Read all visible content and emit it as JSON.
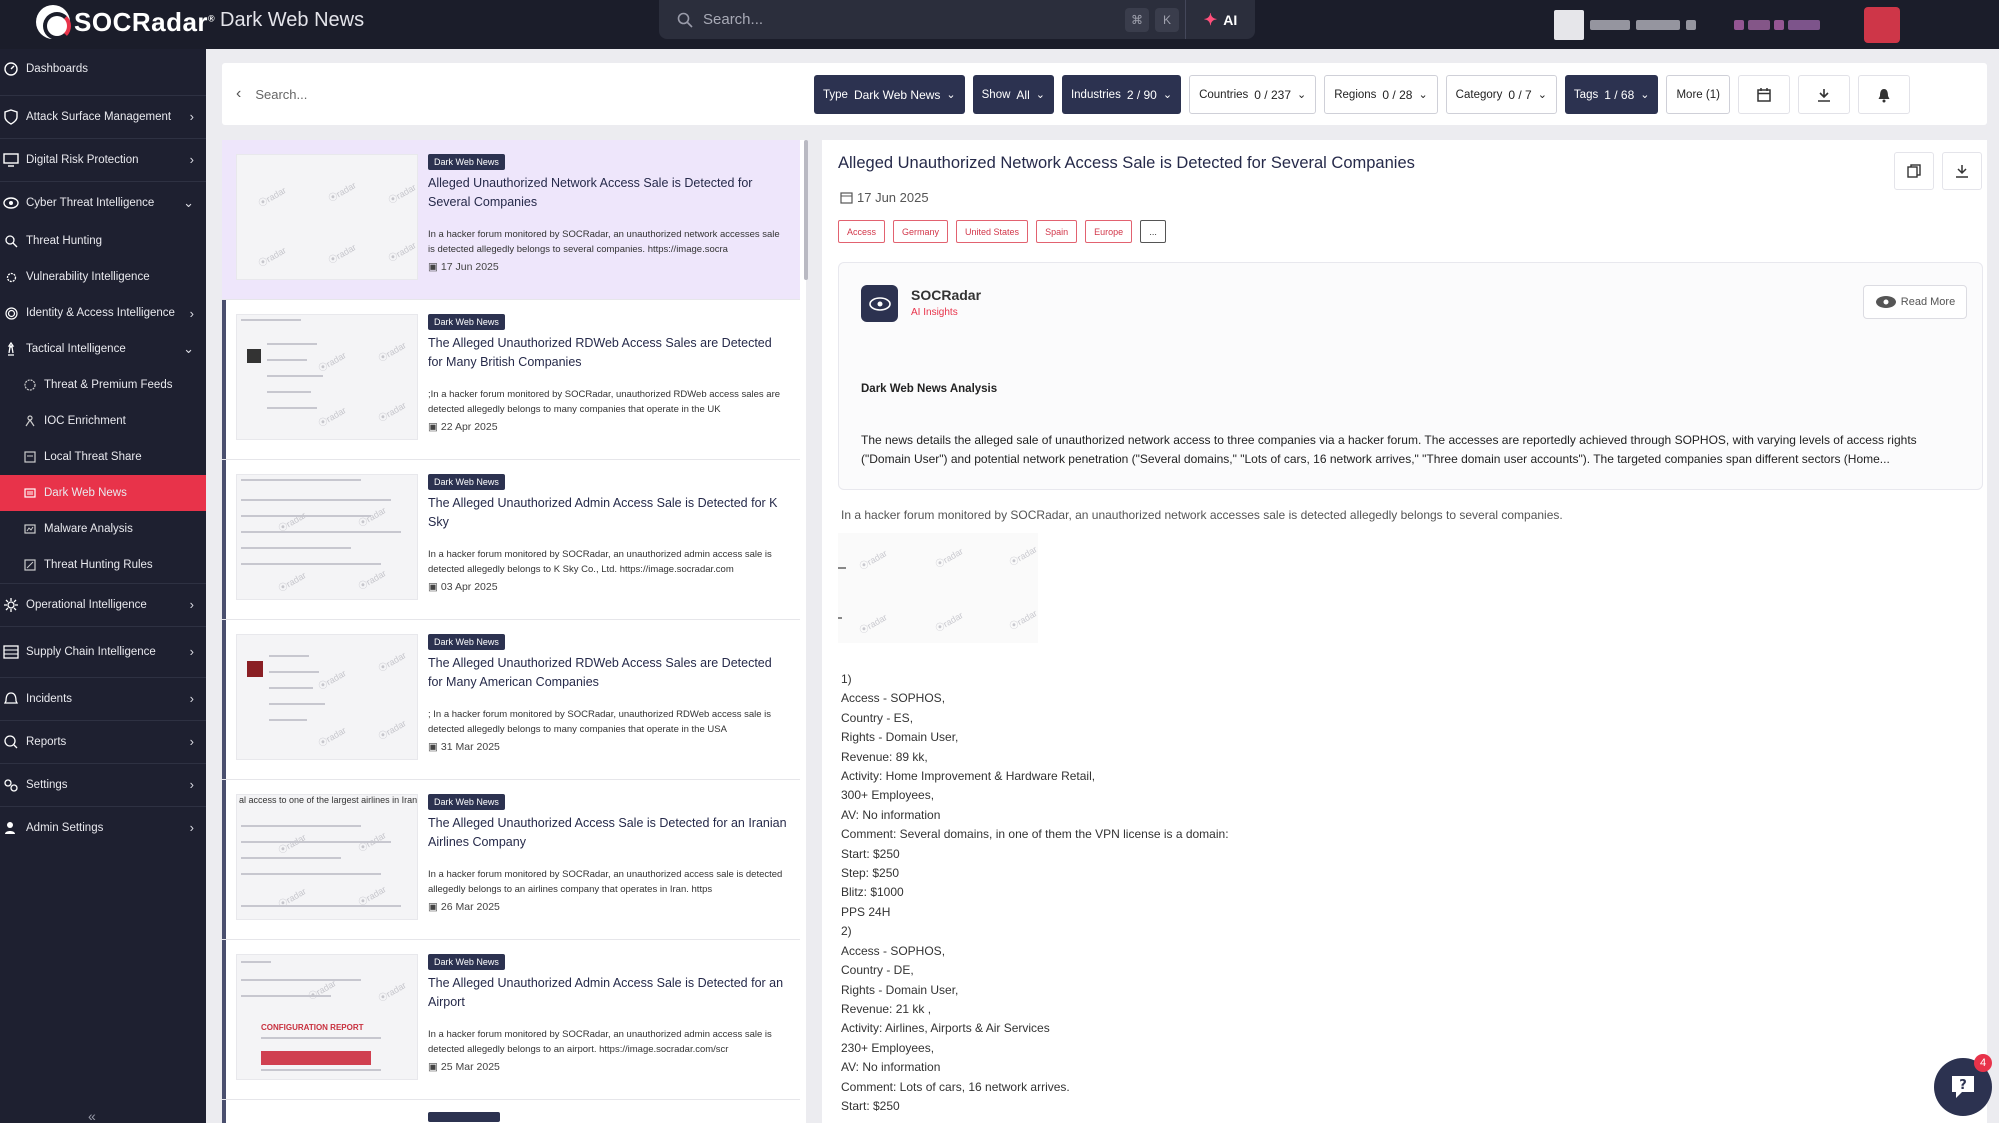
{
  "app": {
    "logo": "SOCRadar",
    "logo_mark": "®",
    "page_title": "Dark Web News"
  },
  "global_search": {
    "placeholder": "Search...",
    "kbd1": "⌘",
    "kbd2": "K",
    "ai_label": "AI"
  },
  "sidebar": {
    "items": [
      {
        "label": "Dashboards",
        "icon": "dashboard-icon",
        "chevron": ""
      },
      {
        "label": "Attack Surface Management",
        "icon": "shield-icon",
        "chevron": "›"
      },
      {
        "label": "Digital Risk Protection",
        "icon": "monitor-icon",
        "chevron": "›"
      },
      {
        "label": "Cyber Threat Intelligence",
        "icon": "eye-icon",
        "chevron": "⌄"
      },
      {
        "label": "Threat Hunting",
        "icon": "search-icon",
        "chevron": ""
      },
      {
        "label": "Vulnerability Intelligence",
        "icon": "gear-icon",
        "chevron": ""
      },
      {
        "label": "Identity & Access Intelligence",
        "icon": "fingerprint-icon",
        "chevron": "›"
      },
      {
        "label": "Tactical Intelligence",
        "icon": "chess-icon",
        "chevron": "⌄"
      },
      {
        "label": "Threat & Premium Feeds",
        "icon": "feed-icon",
        "chevron": ""
      },
      {
        "label": "IOC Enrichment",
        "icon": "network-icon",
        "chevron": ""
      },
      {
        "label": "Local Threat Share",
        "icon": "share-icon",
        "chevron": ""
      },
      {
        "label": "Dark Web News",
        "icon": "news-icon",
        "chevron": ""
      },
      {
        "label": "Malware Analysis",
        "icon": "malware-icon",
        "chevron": ""
      },
      {
        "label": "Threat Hunting Rules",
        "icon": "rules-icon",
        "chevron": ""
      },
      {
        "label": "Operational Intelligence",
        "icon": "cog-icon",
        "chevron": "›"
      },
      {
        "label": "Supply Chain Intelligence",
        "icon": "chain-icon",
        "chevron": "›"
      },
      {
        "label": "Incidents",
        "icon": "alert-icon",
        "chevron": "›"
      },
      {
        "label": "Reports",
        "icon": "report-icon",
        "chevron": "›"
      },
      {
        "label": "Settings",
        "icon": "settings-icon",
        "chevron": "›"
      },
      {
        "label": "Admin Settings",
        "icon": "admin-icon",
        "chevron": "›"
      }
    ],
    "collapse": "«"
  },
  "filters": {
    "search_placeholder": "Search...",
    "chips": [
      {
        "label": "Type",
        "value": "Dark Web News",
        "style": "dark"
      },
      {
        "label": "Show",
        "value": "All",
        "style": "dark"
      },
      {
        "label": "Industries",
        "value": "2 / 90",
        "style": "dark"
      },
      {
        "label": "Countries",
        "value": "0 / 237",
        "style": "light"
      },
      {
        "label": "Regions",
        "value": "0 / 28",
        "style": "light"
      },
      {
        "label": "Category",
        "value": "0 / 7",
        "style": "light"
      },
      {
        "label": "Tags",
        "value": "1 / 68",
        "style": "dark"
      }
    ],
    "more_label": "More (1)"
  },
  "news": [
    {
      "tag": "Dark Web News",
      "title": "Alleged Unauthorized Network Access Sale is Detected for Several Companies",
      "desc": "In a hacker forum monitored by SOCRadar, an unauthorized network accesses sale is detected allegedly belongs to several companies. https://image.socra",
      "date": "17 Jun 2025",
      "thumb_text": ""
    },
    {
      "tag": "Dark Web News",
      "title": "The Alleged Unauthorized RDWeb Access Sales are Detected for Many British Companies",
      "desc": ";In a hacker forum monitored by SOCRadar, unauthorized RDWeb access sales are detected allegedly belongs to many companies that operate in the UK",
      "date": "22 Apr 2025",
      "thumb_text": ""
    },
    {
      "tag": "Dark Web News",
      "title": "The Alleged Unauthorized Admin Access Sale is Detected for K Sky",
      "desc": "In a hacker forum monitored by SOCRadar, an unauthorized admin access sale is detected allegedly belongs to K Sky Co., Ltd. https://image.socradar.com",
      "date": "03 Apr 2025",
      "thumb_text": ""
    },
    {
      "tag": "Dark Web News",
      "title": "The Alleged Unauthorized RDWeb Access Sales are Detected for Many American Companies",
      "desc": "; In a hacker forum monitored by SOCRadar, unauthorized RDWeb access sale is detected allegedly belongs to many companies that operate in the USA",
      "date": "31 Mar 2025",
      "thumb_text": ""
    },
    {
      "tag": "Dark Web News",
      "title": "The Alleged Unauthorized Access Sale is Detected for an Iranian Airlines Company",
      "desc": "In a hacker forum monitored by SOCRadar, an unauthorized access sale is detected allegedly belongs to an airlines company that operates in Iran. https",
      "date": "26 Mar 2025",
      "thumb_text": "al access to one of the largest airlines in Iran"
    },
    {
      "tag": "Dark Web News",
      "title": "The Alleged Unauthorized Admin Access Sale is Detected for an Airport",
      "desc": "In a hacker forum monitored by SOCRadar, an unauthorized admin access sale is detected allegedly belongs to an airport. https://image.socradar.com/scr",
      "date": "25 Mar 2025",
      "thumb_text": "CONFIGURATION REPORT"
    }
  ],
  "detail": {
    "title": "Alleged Unauthorized Network Access Sale is Detected for Several Companies",
    "date": "17 Jun 2025",
    "tags": [
      "Access",
      "Germany",
      "United States",
      "Spain",
      "Europe"
    ],
    "tags_more": "...",
    "insight": {
      "brand": "SOCRadar",
      "sub": "AI Insights",
      "read_more": "Read More",
      "heading": "Dark Web News Analysis",
      "text": "The news details the alleged sale of unauthorized network access to three companies via a hacker forum. The accesses are reportedly achieved through SOPHOS, with varying levels of access rights (\"Domain User\") and potential network penetration (\"Several domains,\" \"Lots of cars, 16 network arrives,\" \"Three domain user accounts\"). The targeted companies span different sectors (Home..."
    },
    "summary": "In a hacker forum monitored by SOCRadar, an unauthorized network accesses sale is detected allegedly belongs to several companies.",
    "body": "1)\nAccess - SOPHOS,\nCountry - ES,\nRights - Domain User,\nRevenue: 89 kk,\nActivity: Home Improvement & Hardware Retail,\n300+ Employees,\nAV: No information\nComment: Several domains, in one of them the VPN license is a domain:\nStart: $250\nStep: $250\nBlitz: $1000\nPPS 24H\n2)\nAccess - SOPHOS,\nCountry - DE,\nRights - Domain User,\nRevenue: 21 kk ,\nActivity: Airlines, Airports & Air Services\n230+ Employees,\nAV: No information\nComment: Lots of cars, 16 network arrives.\nStart: $250"
  },
  "chat": {
    "badge": "4"
  }
}
